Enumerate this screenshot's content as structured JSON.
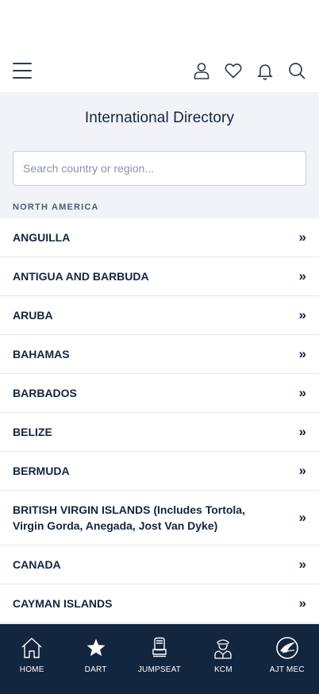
{
  "header": {
    "icons": [
      "menu-icon",
      "user-icon",
      "heart-icon",
      "bell-icon",
      "search-icon"
    ]
  },
  "page": {
    "title": "International Directory"
  },
  "search": {
    "placeholder": "Search country or region..."
  },
  "region": {
    "label": "NORTH AMERICA"
  },
  "countries": [
    {
      "name": "ANGUILLA",
      "chevron": "»"
    },
    {
      "name": "ANTIGUA AND BARBUDA",
      "chevron": "»"
    },
    {
      "name": "ARUBA",
      "chevron": "»"
    },
    {
      "name": "BAHAMAS",
      "chevron": "»"
    },
    {
      "name": "BARBADOS",
      "chevron": "»"
    },
    {
      "name": "BELIZE",
      "chevron": "»"
    },
    {
      "name": "BERMUDA",
      "chevron": "»"
    },
    {
      "name": "BRITISH VIRGIN ISLANDS (Includes Tortola, Virgin Gorda, Anegada, Jost Van Dyke)",
      "chevron": "»"
    },
    {
      "name": "CANADA",
      "chevron": "»"
    },
    {
      "name": "CAYMAN ISLANDS",
      "chevron": "»"
    }
  ],
  "bottom_nav": [
    {
      "label": "HOME",
      "icon": "home-icon"
    },
    {
      "label": "DART",
      "icon": "star-icon"
    },
    {
      "label": "JUMPSEAT",
      "icon": "jumpseat-icon"
    },
    {
      "label": "KCM",
      "icon": "pilot-icon"
    },
    {
      "label": "AJT MEC",
      "icon": "ajt-logo-icon"
    }
  ],
  "colors": {
    "navy": "#13263f",
    "background": "#f1f3f7"
  }
}
